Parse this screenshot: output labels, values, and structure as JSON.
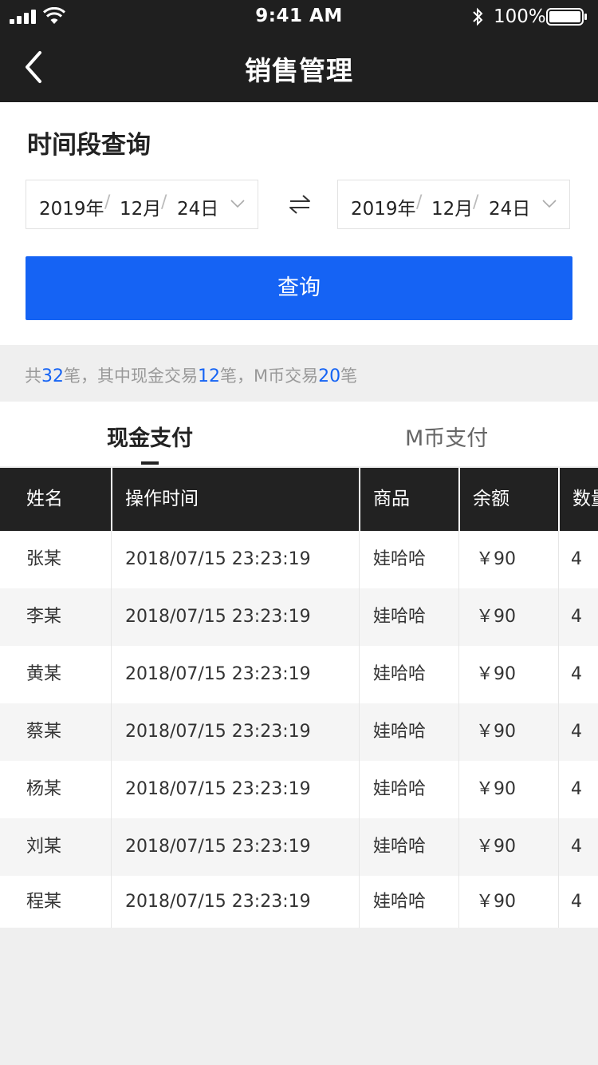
{
  "status_bar": {
    "time": "9:41 AM",
    "battery": "100%",
    "icons": [
      "signal-icon",
      "wifi-icon",
      "bluetooth-icon",
      "battery-icon"
    ]
  },
  "nav": {
    "title": "销售管理",
    "back_icon": "chevron-left-icon"
  },
  "query": {
    "section_title": "时间段查询",
    "start_date": {
      "year": "2019年",
      "month": "12月",
      "day": "24日",
      "sep": "/"
    },
    "end_date": {
      "year": "2019年",
      "month": "12月",
      "day": "24日",
      "sep": "/"
    },
    "swap_icon": "swap-icon",
    "button_label": "查询"
  },
  "summary": {
    "prefix": "共",
    "total": "32",
    "mid1": "笔，其中现金交易",
    "cash": "12",
    "mid2": "笔，M币交易",
    "mcoin": "20",
    "suffix": "笔"
  },
  "tabs": [
    {
      "label": "现金支付",
      "active": true
    },
    {
      "label": "M币支付",
      "active": false
    }
  ],
  "table": {
    "headers": [
      "姓名",
      "操作时间",
      "商品",
      "余额",
      "数量"
    ],
    "rows": [
      [
        "张某",
        "2018/07/15 23:23:19",
        "娃哈哈",
        "￥90",
        "4"
      ],
      [
        "李某",
        "2018/07/15 23:23:19",
        "娃哈哈",
        "￥90",
        "4"
      ],
      [
        "黄某",
        "2018/07/15 23:23:19",
        "娃哈哈",
        "￥90",
        "4"
      ],
      [
        "蔡某",
        "2018/07/15 23:23:19",
        "娃哈哈",
        "￥90",
        "4"
      ],
      [
        "杨某",
        "2018/07/15 23:23:19",
        "娃哈哈",
        "￥90",
        "4"
      ],
      [
        "刘某",
        "2018/07/15 23:23:19",
        "娃哈哈",
        "￥90",
        "4"
      ],
      [
        "程某",
        "2018/07/15 23:23:19",
        "娃哈哈",
        "￥90",
        "4"
      ]
    ]
  },
  "colors": {
    "header_bg": "#1f1f1f",
    "accent": "#1563f4",
    "table_header_bg": "#222222",
    "page_bg": "#efefef"
  }
}
